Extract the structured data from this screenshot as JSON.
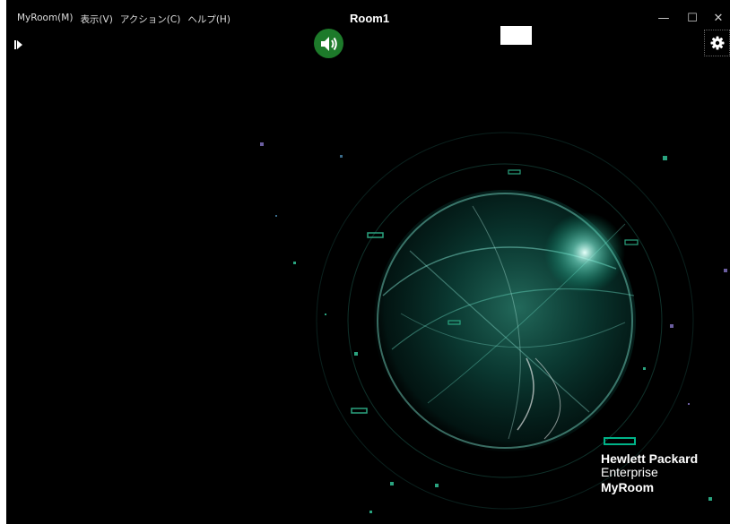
{
  "window": {
    "title": "Room1",
    "controls": {
      "minimize": "—",
      "maximize": "☐",
      "close": "✕"
    }
  },
  "menu": {
    "items": [
      "MyRoom(M)",
      "表示(V)",
      "アクション(C)",
      "ヘルプ(H)"
    ]
  },
  "toolbar": {
    "expand_icon": "expand-panel-icon",
    "speaker_icon": "speaker-icon",
    "settings_icon": "gear-icon"
  },
  "branding": {
    "line1": "Hewlett Packard",
    "line2": "Enterprise",
    "line3": "MyRoom"
  },
  "colors": {
    "accent_green": "#00b388",
    "speaker_bg": "#1d7a2a"
  }
}
